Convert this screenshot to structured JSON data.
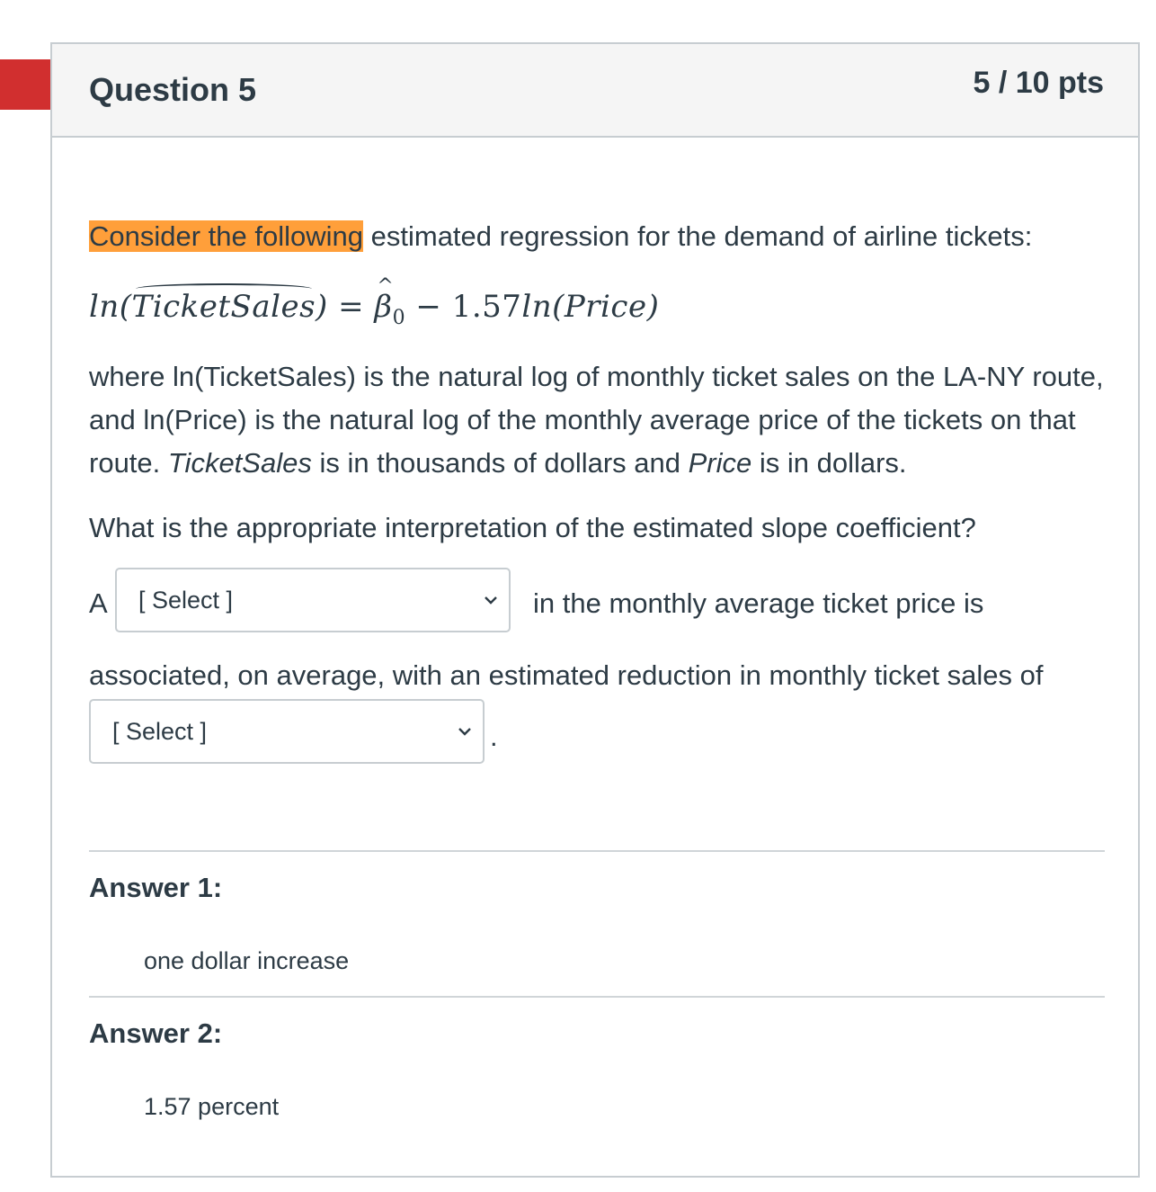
{
  "question": {
    "title": "Question 5",
    "points": "5 / 10 pts",
    "intro_highlight": "Consider the following",
    "intro_rest": " estimated regression for the demand of airline tickets:",
    "formula": {
      "lhs_prefix": "ln(",
      "lhs_hat": "TicketSales",
      "lhs_suffix": ")",
      "equals": " = ",
      "beta": "β",
      "beta_sub": "0",
      "minus": " − ",
      "coef": "1.57",
      "rhs": "ln(Price)"
    },
    "description_1": "where ln(TicketSales) is the natural log of monthly ticket sales on the LA-NY route, and ln(Price) is the natural log of the monthly average price of the tickets on that route. ",
    "description_ticketsales": "TicketSales",
    "description_2": " is in thousands of dollars and ",
    "description_price": "Price",
    "description_3": " is in dollars.",
    "prompt": "What is the appropriate interpretation of the estimated slope coefficient?",
    "sentence_start": "A",
    "sentence_middle": "in the monthly average ticket price is",
    "sentence_line2": "associated, on average, with an estimated reduction in monthly ticket sales of",
    "sentence_end": ".",
    "select_1_value": "[ Select ]",
    "select_2_value": "[ Select ]"
  },
  "answers": [
    {
      "label": "Answer 1:",
      "value": "one dollar increase"
    },
    {
      "label": "Answer 2:",
      "value": "1.57 percent"
    }
  ],
  "colors": {
    "flag": "#d12f2f",
    "highlight": "#ff9f3a",
    "text": "#2d3b45",
    "border": "#c7cdd1"
  }
}
